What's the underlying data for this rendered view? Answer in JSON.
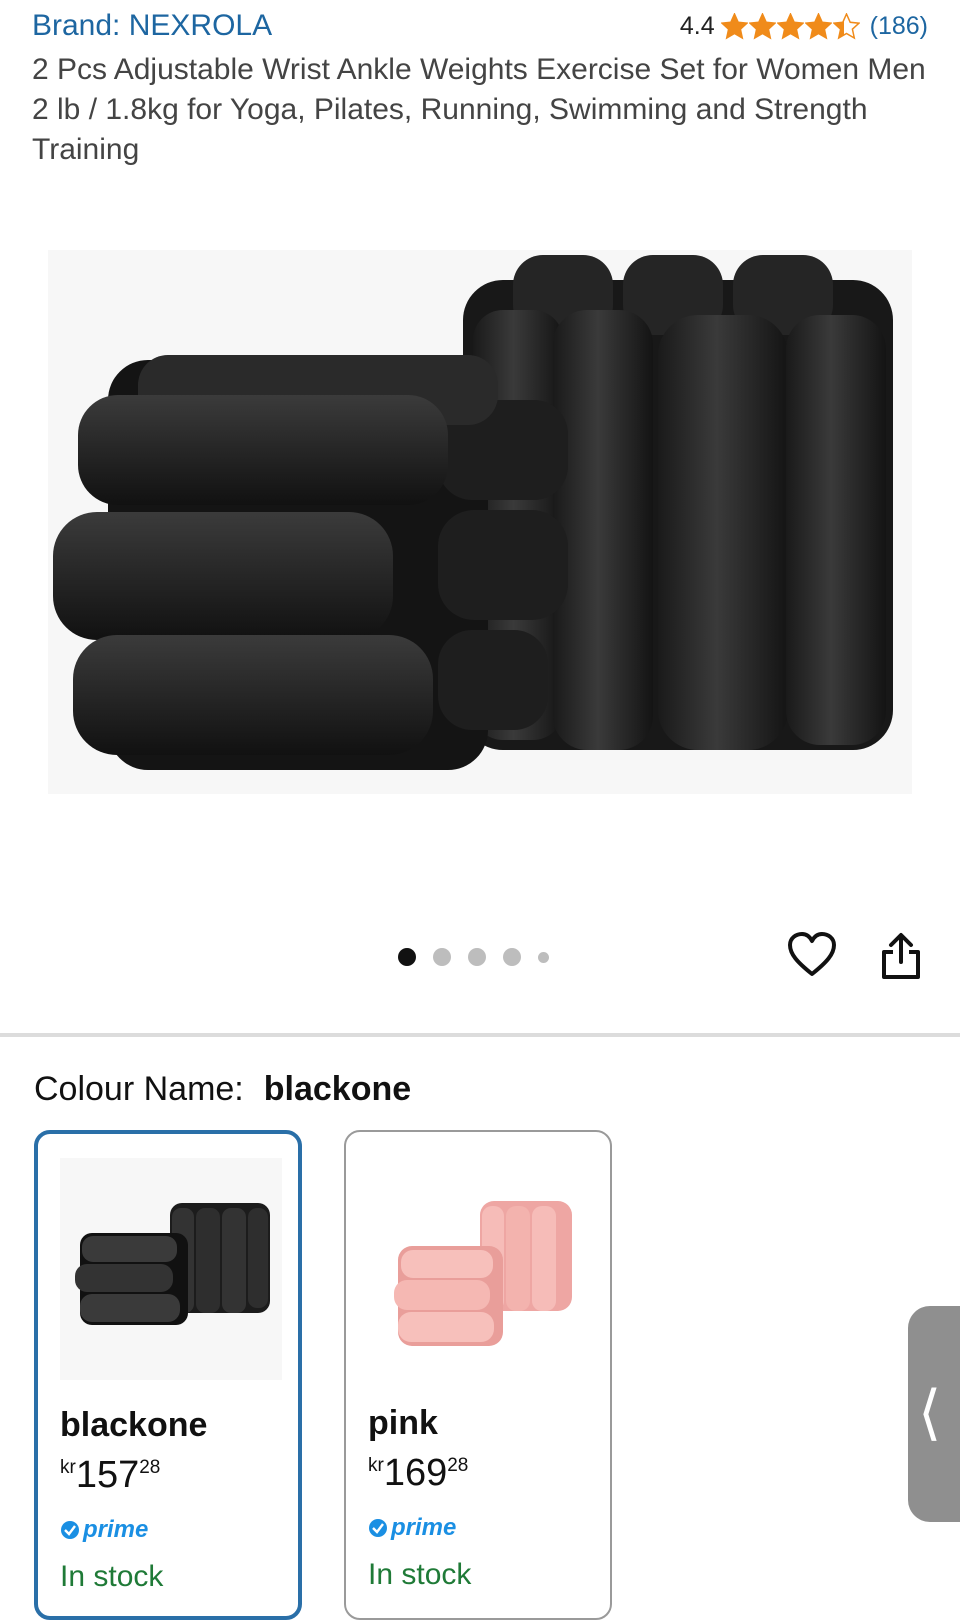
{
  "product": {
    "brand": "Brand: NEXROLA",
    "rating_value": "4.4",
    "rating_stars": 4.4,
    "review_count": "(186)",
    "title": "2 Pcs Adjustable Wrist Ankle Weights Exercise Set for Women Men 2 lb / 1.8kg for Yoga, Pilates, Running, Swimming and Strength Training"
  },
  "gallery": {
    "image_count": 5,
    "active_index": 0
  },
  "actions": {
    "wishlist_icon": "heart-icon",
    "share_icon": "share-icon"
  },
  "colour": {
    "label": "Colour Name:",
    "selected": "blackone",
    "options": [
      {
        "name": "blackone",
        "currency": "kr",
        "price_whole": "157",
        "price_fraction": "28",
        "prime": "prime",
        "stock": "In stock",
        "color": "#2b2b2b"
      },
      {
        "name": "pink",
        "currency": "kr",
        "price_whole": "169",
        "price_fraction": "28",
        "prime": "prime",
        "stock": "In stock",
        "color": "#f4b4b0"
      }
    ]
  },
  "colors": {
    "link": "#1d66a1",
    "star": "#f08b1a",
    "selected_border": "#2a6fa8",
    "in_stock": "#1f7a37",
    "prime": "#1a8fe3"
  }
}
